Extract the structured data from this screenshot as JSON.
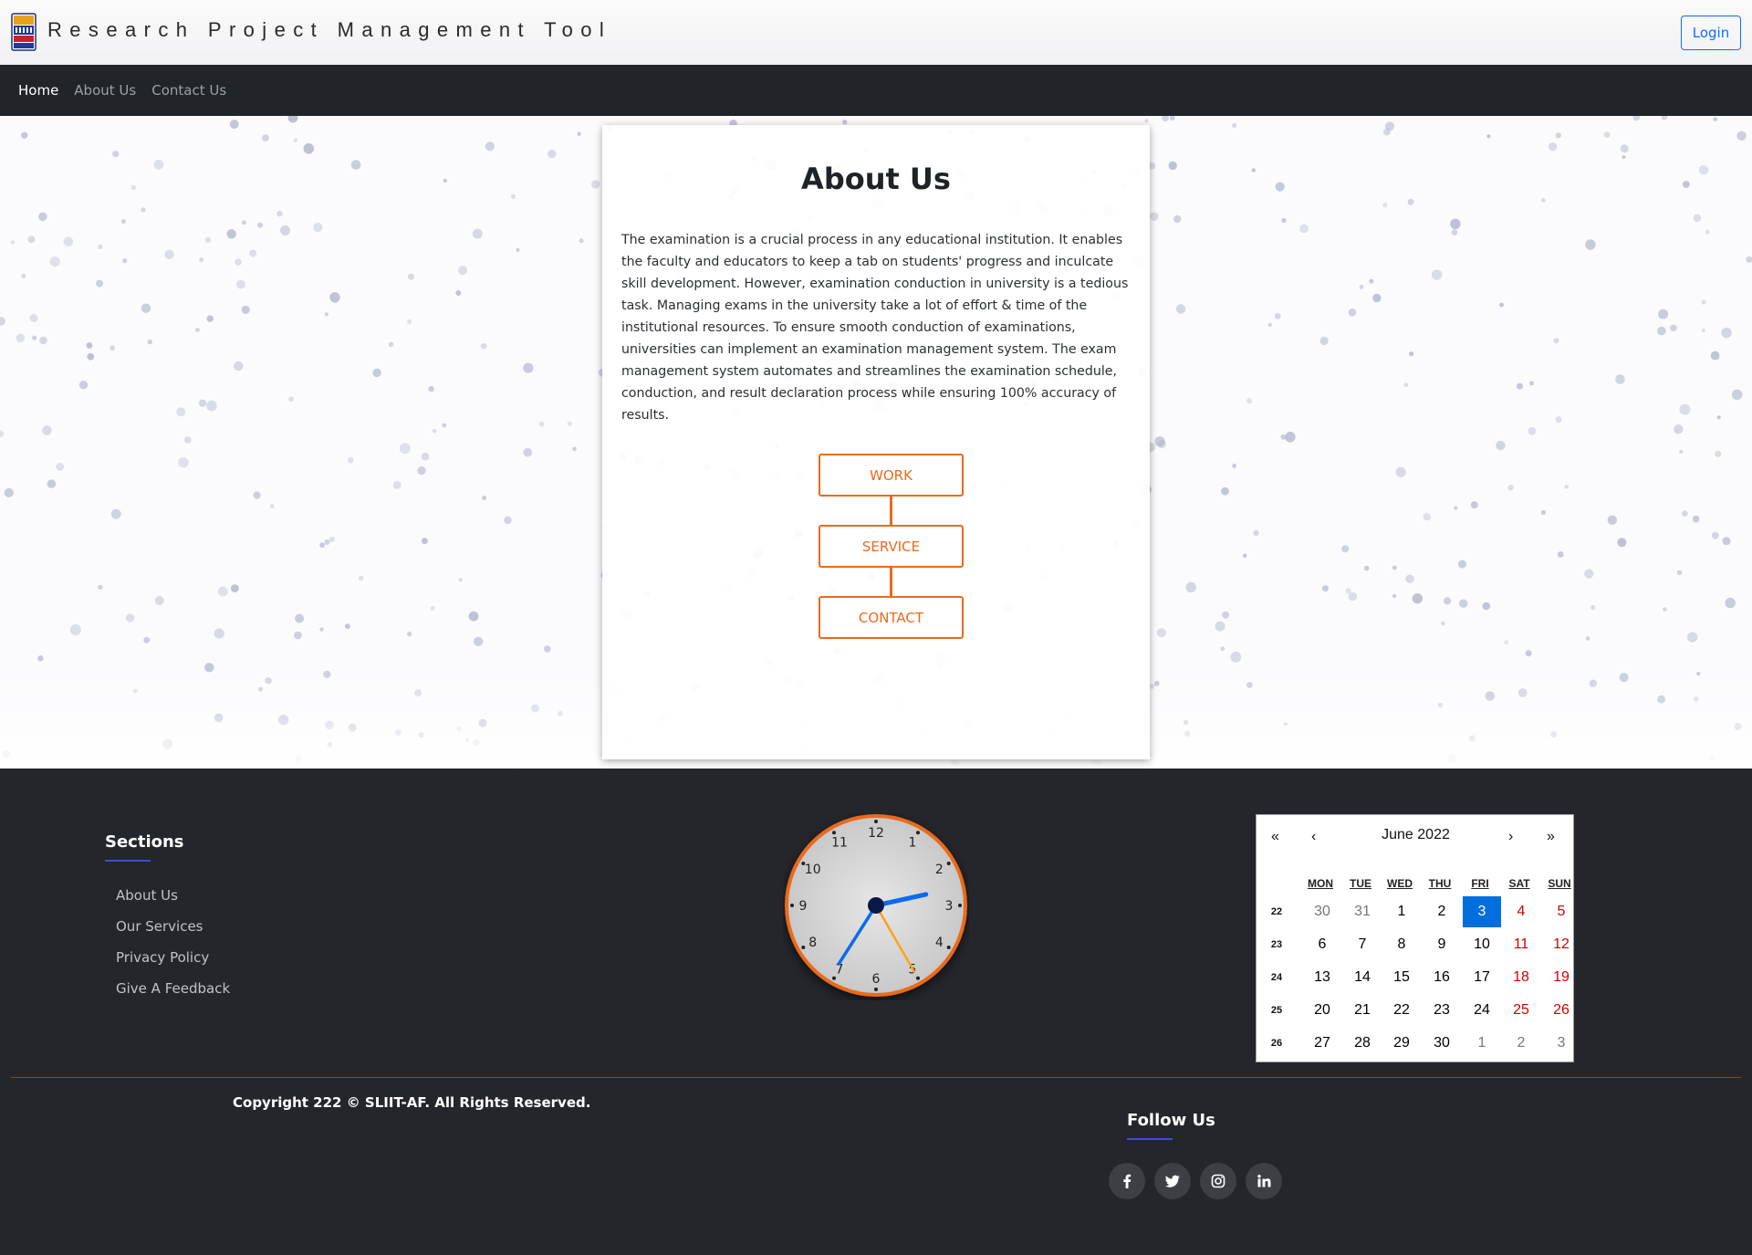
{
  "header": {
    "brand": "Research Project Management Tool",
    "login_label": "Login"
  },
  "nav": {
    "items": [
      "Home",
      "About Us",
      "Contact Us"
    ]
  },
  "about": {
    "title": "About Us",
    "body": "The examination is a crucial process in any educational institution. It enables the faculty and educators to keep a tab on students' progress and inculcate skill development. However, examination conduction in university is a tedious task. Managing exams in the university take a lot of effort & time of the institutional resources. To ensure smooth conduction of examinations, universities can implement an examination management system. The exam management system automates and streamlines the examination schedule, conduction, and result declaration process while ensuring 100% accuracy of results.",
    "flow": [
      "WORK",
      "SERVICE",
      "CONTACT"
    ]
  },
  "footer": {
    "sections_title": "Sections",
    "section_links": [
      "About Us",
      "Our Services",
      "Privacy Policy",
      "Give A Feedback"
    ],
    "copyright": "Copyright 222 © SLIIT-AF. All Rights Reserved.",
    "follow_title": "Follow Us",
    "social_icons": [
      "facebook-icon",
      "twitter-icon",
      "instagram-icon",
      "linkedin-icon"
    ]
  },
  "clock": {
    "numbers": [
      "12",
      "1",
      "2",
      "3",
      "4",
      "5",
      "6",
      "7",
      "8",
      "9",
      "10",
      "11"
    ],
    "time": {
      "hour": 2,
      "minute": 35,
      "second": 25
    }
  },
  "calendar": {
    "nav": [
      "«",
      "‹",
      "›",
      "»"
    ],
    "month_label": "June 2022",
    "weekdays": [
      "MON",
      "TUE",
      "WED",
      "THU",
      "FRI",
      "SAT",
      "SUN"
    ],
    "weeks": [
      {
        "week": "22",
        "days": [
          "30",
          "31",
          "1",
          "2",
          "3",
          "4",
          "5"
        ]
      },
      {
        "week": "23",
        "days": [
          "6",
          "7",
          "8",
          "9",
          "10",
          "11",
          "12"
        ]
      },
      {
        "week": "24",
        "days": [
          "13",
          "14",
          "15",
          "16",
          "17",
          "18",
          "19"
        ]
      },
      {
        "week": "25",
        "days": [
          "20",
          "21",
          "22",
          "23",
          "24",
          "25",
          "26"
        ]
      },
      {
        "week": "26",
        "days": [
          "27",
          "28",
          "29",
          "30",
          "1",
          "2",
          "3"
        ]
      }
    ],
    "selected_day": "3",
    "colors": {
      "selected": "#006edc",
      "weekend": "#d10000",
      "outside_month": "#777777"
    }
  },
  "colors": {
    "accent_orange": "#ea6a1b",
    "nav_bg": "#212529",
    "footer_bg": "#24262b",
    "link_blue": "#0d6efd"
  }
}
